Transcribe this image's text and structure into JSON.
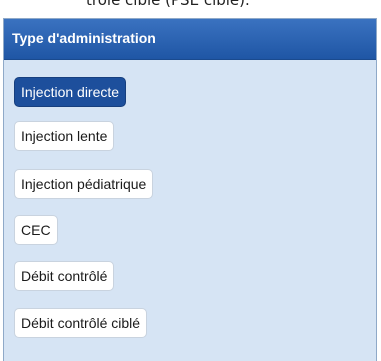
{
  "top_text": "trôlé ciblé (PSE ciblé).",
  "panel": {
    "title": "Type d'administration",
    "options": [
      {
        "label": "Injection directe",
        "selected": true
      },
      {
        "label": "Injection lente",
        "selected": false
      },
      {
        "label": "Injection pédiatrique",
        "selected": false
      },
      {
        "label": "CEC",
        "selected": false
      },
      {
        "label": "Débit contrôlé",
        "selected": false
      },
      {
        "label": "Débit contrôlé ciblé",
        "selected": false
      }
    ]
  },
  "colors": {
    "header": "#2a62b3",
    "panel_bg": "#d6e4f4",
    "selected_bg": "#1d4f9c"
  }
}
